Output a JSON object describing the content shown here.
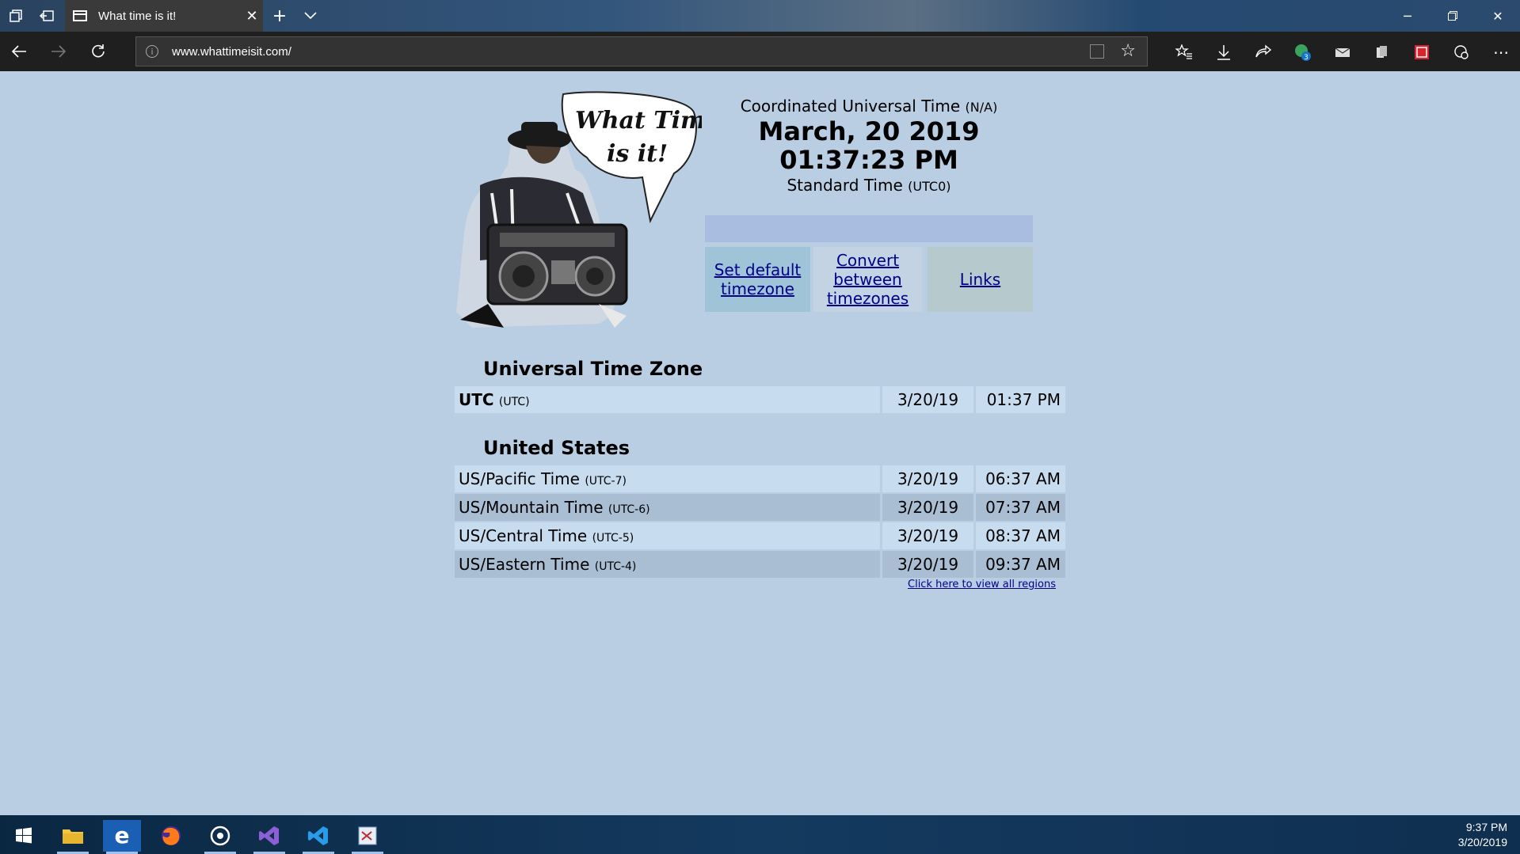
{
  "browser": {
    "tab_title": "What time is it!",
    "url": "www.whattimeisit.com/",
    "extension_badge": "3"
  },
  "page": {
    "logo_text_line1": "What Time",
    "logo_text_line2": "is it!",
    "header": {
      "zone_name": "Coordinated Universal Time",
      "zone_abbr": "(N/A)",
      "date": "March, 20 2019",
      "time": "01:37:23 PM",
      "standard_label": "Standard Time",
      "standard_offset": "(UTC0)"
    },
    "links": {
      "set_default": "Set default timezone",
      "convert": "Convert between timezones",
      "links": "Links"
    },
    "sections": [
      {
        "title": "Universal Time Zone",
        "rows": [
          {
            "name": "UTC",
            "offset": "(UTC)",
            "date": "3/20/19",
            "time": "01:37 PM"
          }
        ]
      },
      {
        "title": "United States",
        "rows": [
          {
            "name": "US/Pacific Time",
            "offset": "(UTC-7)",
            "date": "3/20/19",
            "time": "06:37 AM"
          },
          {
            "name": "US/Mountain Time",
            "offset": "(UTC-6)",
            "date": "3/20/19",
            "time": "07:37 AM"
          },
          {
            "name": "US/Central Time",
            "offset": "(UTC-5)",
            "date": "3/20/19",
            "time": "08:37 AM"
          },
          {
            "name": "US/Eastern Time",
            "offset": "(UTC-4)",
            "date": "3/20/19",
            "time": "09:37 AM"
          }
        ]
      }
    ],
    "all_regions_link": "Click here to view all regions"
  },
  "taskbar": {
    "clock_time": "9:37 PM",
    "clock_date": "3/20/2019",
    "apps": [
      "start-icon",
      "file-explorer-icon",
      "edge-icon",
      "firefox-icon",
      "groove-music-icon",
      "visual-studio-icon",
      "vscode-icon",
      "snipping-tool-icon"
    ]
  },
  "colors": {
    "page_bg": "#b9cde3",
    "row_light": "#c8dcf0",
    "row_dark": "#a9bdd3",
    "link": "#00008b"
  }
}
